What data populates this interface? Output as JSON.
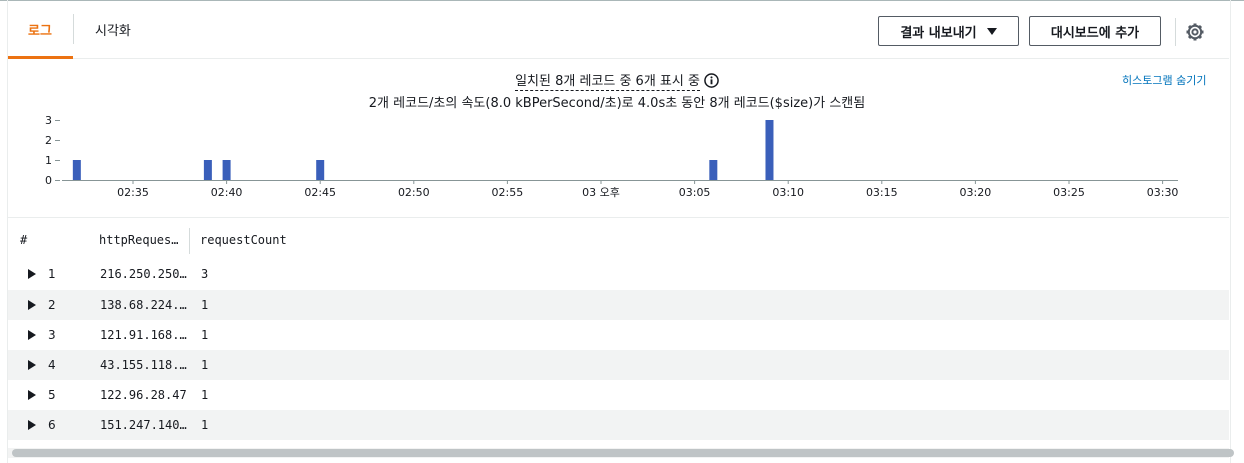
{
  "tabs": {
    "logs": "로그",
    "visualization": "시각화"
  },
  "buttons": {
    "export": "결과 내보내기",
    "add_dashboard": "대시보드에 추가"
  },
  "icons": {
    "settings": "gear-icon",
    "info": "info-icon",
    "export_caret": "caret-down-icon",
    "row_expand": "triangle-right-icon"
  },
  "colors": {
    "accent": "#ec7211",
    "bar": "#3a5fba",
    "link": "#0073bb"
  },
  "summary": {
    "matched": "일치된 8개 레코드 중 6개 표시 중",
    "scan": "2개 레코드/초의 속도(8.0 kBPerSecond/초)로 4.0s초 동안 8개 레코드($size)가 스캔됨"
  },
  "hide_histogram": "히스토그램 숨기기",
  "chart_data": {
    "type": "bar",
    "x_ticks": [
      "02:35",
      "02:40",
      "02:45",
      "02:50",
      "02:55",
      "03 오후",
      "03:05",
      "03:10",
      "03:15",
      "03:20",
      "03:25",
      "03:30"
    ],
    "y_ticks": [
      "0",
      "1",
      "2",
      "3"
    ],
    "ylim": [
      0,
      3
    ],
    "bars": [
      {
        "time": "02:32",
        "value": 1
      },
      {
        "time": "02:39",
        "value": 1
      },
      {
        "time": "02:40",
        "value": 1
      },
      {
        "time": "02:45",
        "value": 1
      },
      {
        "time": "03:06",
        "value": 1
      },
      {
        "time": "03:09",
        "value": 3
      }
    ],
    "grid": false
  },
  "table": {
    "headers": [
      "#",
      "httpReques…",
      "requestCount"
    ],
    "rows": [
      {
        "index": "1",
        "ip": "216.250.250…",
        "count": "3"
      },
      {
        "index": "2",
        "ip": "138.68.224.…",
        "count": "1"
      },
      {
        "index": "3",
        "ip": "121.91.168.…",
        "count": "1"
      },
      {
        "index": "4",
        "ip": "43.155.118.…",
        "count": "1"
      },
      {
        "index": "5",
        "ip": "122.96.28.47",
        "count": "1"
      },
      {
        "index": "6",
        "ip": "151.247.140…",
        "count": "1"
      }
    ]
  }
}
